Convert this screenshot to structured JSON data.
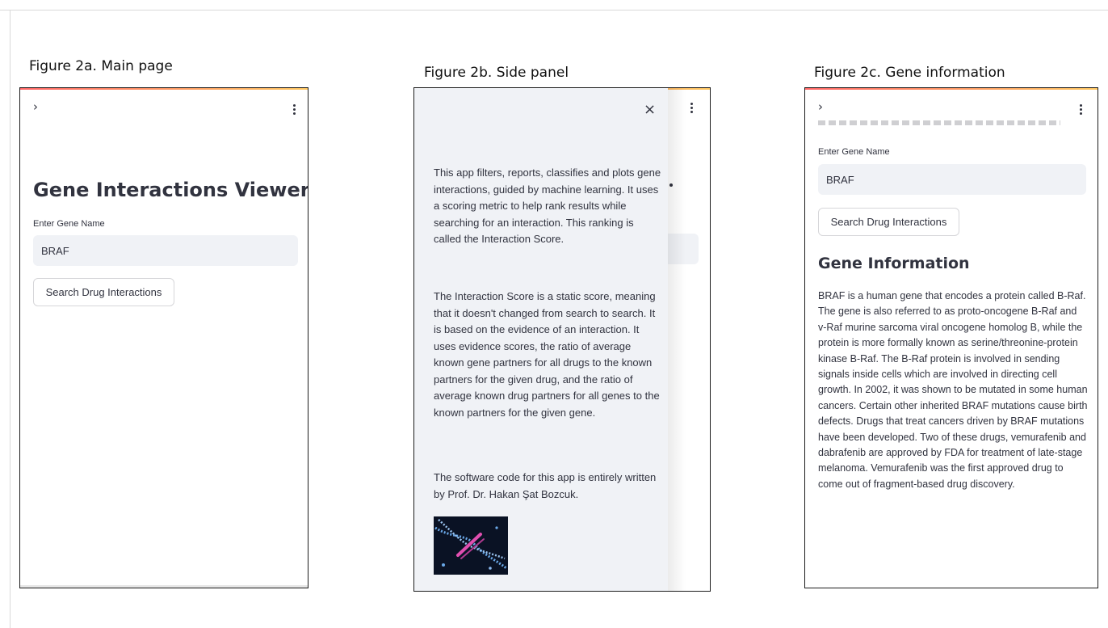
{
  "figures": [
    {
      "caption": "Figure 2a. Main page",
      "app_title": "Gene Interactions Viewer",
      "input_label": "Enter Gene Name",
      "input_value": "BRAF",
      "button_label": "Search Drug Interactions"
    },
    {
      "caption": "Figure 2b. Side panel",
      "paragraphs": [
        "This app filters, reports, classifies and plots gene interactions, guided by machine learning. It uses a scoring metric to help rank results while searching for an interaction. This ranking is called the Interaction Score.",
        "The Interaction Score is a static score, meaning that it doesn't changed from search to search. It is based on the evidence of an interaction.  It uses evidence scores, the ratio of average known gene partners for all drugs to the known partners for the given drug, and the ratio of average known drug partners for all genes to the known partners for the given gene.",
        "The software code for this app is entirely written by Prof. Dr. Hakan Şat Bozcuk."
      ]
    },
    {
      "caption": "Figure 2c. Gene information",
      "input_label": "Enter Gene Name",
      "input_value": "BRAF",
      "button_label": "Search Drug Interactions",
      "section_title": "Gene Information",
      "gene_text": "BRAF is a human gene that encodes a protein called B-Raf. The gene is also referred to as proto-oncogene B-Raf and v-Raf murine sarcoma viral oncogene homolog B, while the protein is more formally known as serine/threonine-protein kinase B-Raf. The B-Raf protein is involved in sending signals inside cells which are involved in directing cell growth. In 2002, it was shown to be mutated in some human cancers. Certain other inherited BRAF mutations cause birth defects. Drugs that treat cancers driven by BRAF mutations have been developed. Two of these drugs, vemurafenib and dabrafenib are approved by FDA for treatment of late-stage melanoma. Vemurafenib was the first approved drug to come out of fragment-based drug discovery."
    }
  ],
  "icons": {
    "expand": "›",
    "close": "×",
    "menu": "kebab-menu-icon"
  },
  "colors": {
    "input_bg": "#f0f2f6",
    "panel_bg": "#f0f2f6",
    "text": "#31333f"
  }
}
